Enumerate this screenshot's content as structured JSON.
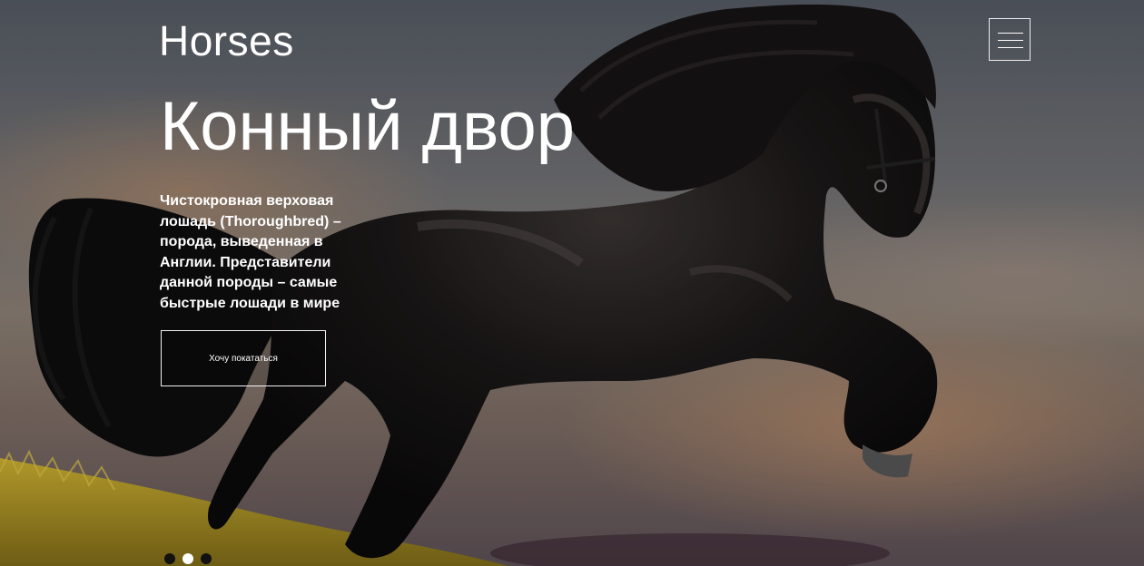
{
  "header": {
    "logo": "Horses",
    "menu_icon": "hamburger-menu-icon"
  },
  "hero": {
    "title": "Конный двор",
    "description": "Чистокровная верховая лошадь (Thoroughbred) – порода, выведенная в Англии. Представители данной породы – самые быстрые лошади в мире",
    "cta_label": "Хочу покататься",
    "background_image": "black horse rearing on grass at sunset"
  },
  "slider": {
    "dot_count": 3,
    "active_index": 1
  },
  "colors": {
    "text": "#ffffff",
    "dot_inactive": "#111111",
    "dot_active": "#ffffff",
    "grass": "#b8a02a"
  }
}
